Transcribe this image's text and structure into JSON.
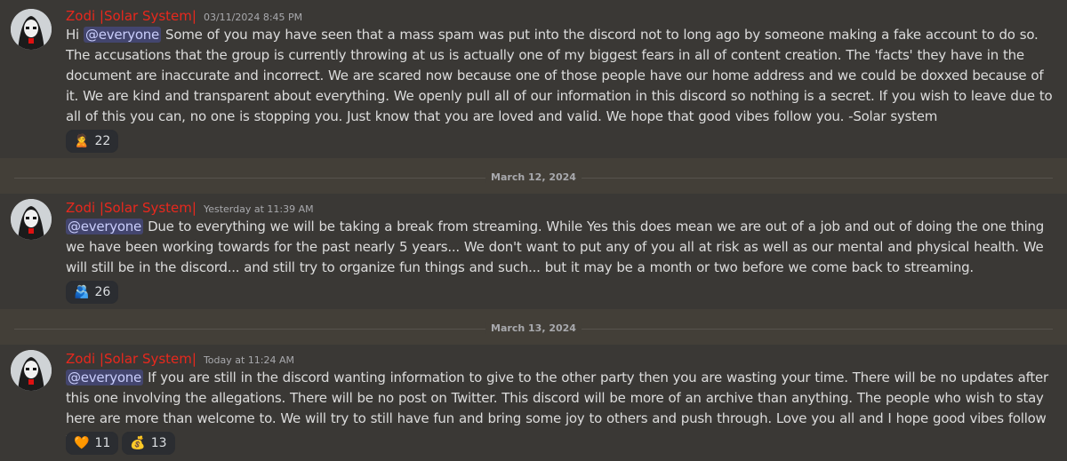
{
  "messages": [
    {
      "author": "Zodi |Solar System|",
      "timestamp": "03/11/2024 8:45 PM",
      "greeting": "Hi",
      "mention": "@everyone",
      "body": " Some of you may have seen that a mass spam was put into the discord not to long ago by someone making a fake account to do so. The accusations that the group is currently throwing at us is actually one of my biggest fears in all of content creation. The 'facts' they have in the document are inaccurate and incorrect. We are scared now because one of those people have our home address and we could be doxxed because of it. We are kind and transparent about everything. We openly pull all of our information in this discord so nothing is a secret. If you wish to leave due to all of this you can, no one is stopping you. Just know that you are loved and valid. We hope that good vibes follow you. -Solar system",
      "reactions": [
        {
          "emoji": "🙎",
          "count": "22"
        }
      ]
    },
    {
      "author": "Zodi |Solar System|",
      "timestamp": "Yesterday at 11:39 AM",
      "mention": "@everyone",
      "body": " Due to everything we will be taking a break from streaming. While Yes this does mean we are out of a job and out of doing the one thing we have been working towards for the past nearly 5 years... We don't want to put any of you all at risk as well as our mental and physical health. We will still be in the discord... and still try to organize fun things and such... but it may be a month or two before we come back to streaming.",
      "reactions": [
        {
          "emoji": "🫂",
          "count": "26"
        }
      ]
    },
    {
      "author": "Zodi |Solar System|",
      "timestamp": "Today at 11:24 AM",
      "mention": "@everyone",
      "body": " If you are still in the discord wanting information to give to the other party then you are wasting your time. There will be no updates after this one involving the allegations. There will be no post on Twitter. This discord will be more of an archive than anything. The people who wish to stay here are more than welcome to. We will try to still have fun and bring some joy to others and push through. Love you all and I hope good vibes follow you.",
      "reactions": [
        {
          "emoji": "🧡",
          "count": "11"
        },
        {
          "emoji": "💰",
          "count": "13"
        }
      ]
    }
  ],
  "dividers": [
    "March 12, 2024",
    "March 13, 2024"
  ],
  "colors": {
    "author": "#e8281d",
    "mention_bg": "#5865f2",
    "background": "#433f38"
  }
}
